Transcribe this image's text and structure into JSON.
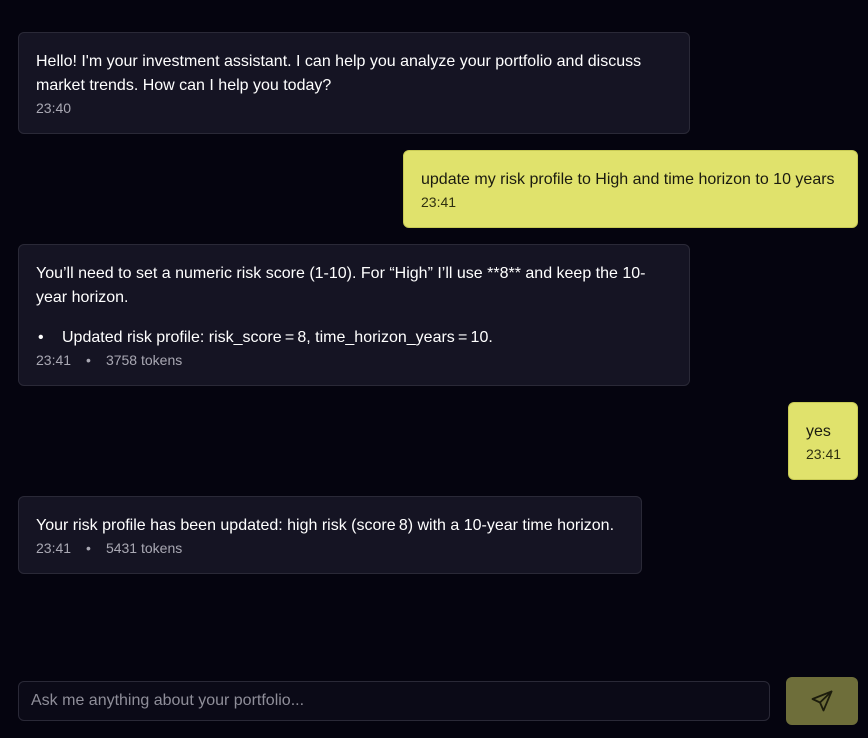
{
  "messages": [
    {
      "role": "assistant",
      "text": "Hello! I'm your investment assistant. I can help you analyze your portfolio and discuss market trends. How can I help you today?",
      "time": "23:40"
    },
    {
      "role": "user",
      "text": "update my risk profile to High and time horizon to 10 years",
      "time": "23:41"
    },
    {
      "role": "assistant",
      "text": "You’ll need to set a numeric risk score (1-10). For “High” I’ll use **8** and keep the 10-year horizon.",
      "bullet": "Updated risk profile: risk_score = 8, time_horizon_years = 10.",
      "bullet_marker": "•",
      "time": "23:41",
      "separator": "•",
      "tokens": "3758 tokens"
    },
    {
      "role": "user",
      "text": "yes",
      "time": "23:41"
    },
    {
      "role": "assistant",
      "text": "Your risk profile has been updated: high risk (score 8) with a 10-year time horizon.",
      "time": "23:41",
      "separator": "•",
      "tokens": "5431 tokens"
    }
  ],
  "composer": {
    "placeholder": "Ask me anything about your portfolio...",
    "value": ""
  },
  "send_button": {
    "icon": "send-icon"
  },
  "colors": {
    "background": "#05040f",
    "assistant_bubble": "#151423",
    "user_bubble": "#e0e26c",
    "send_button": "#6e6e3a"
  }
}
